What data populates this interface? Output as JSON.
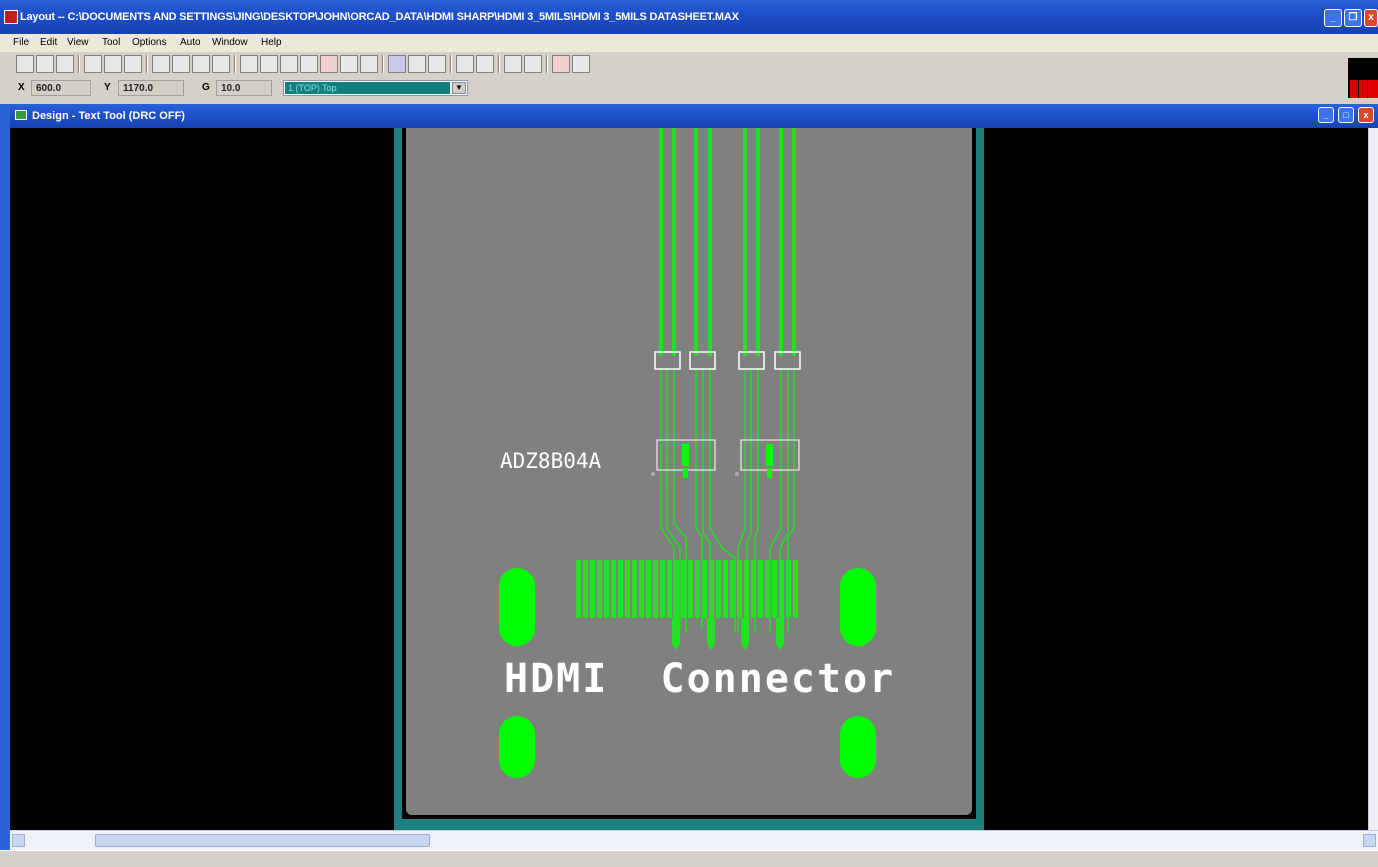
{
  "app": {
    "title": "Layout -- C:\\DOCUMENTS AND SETTINGS\\JING\\DESKTOP\\JOHN\\ORCAD_DATA\\HDMI SHARP\\HDMI 3_5MILS\\HDMI 3_5MILS DATASHEET.MAX"
  },
  "menu": {
    "items": [
      "File",
      "Edit",
      "View",
      "Tool",
      "Options",
      "Auto",
      "Window",
      "Help"
    ]
  },
  "coords": {
    "x_label": "X",
    "x_value": "600.0",
    "y_label": "Y",
    "y_value": "1170.0",
    "g_label": "G",
    "g_value": "10.0",
    "layer_value": "1 (TOP) Top"
  },
  "design_window": {
    "title": "Design - Text Tool (DRC OFF)"
  },
  "pcb": {
    "part_label": "ADZ8B04A",
    "connector_label": "HDMI  Connector"
  },
  "colors": {
    "board": "#808080",
    "board_outline": "#1e7f7f",
    "trace": "#22e022",
    "pad": "#00ff00",
    "silkscreen": "#ffffff",
    "titlebar": "#1e4fc8"
  }
}
